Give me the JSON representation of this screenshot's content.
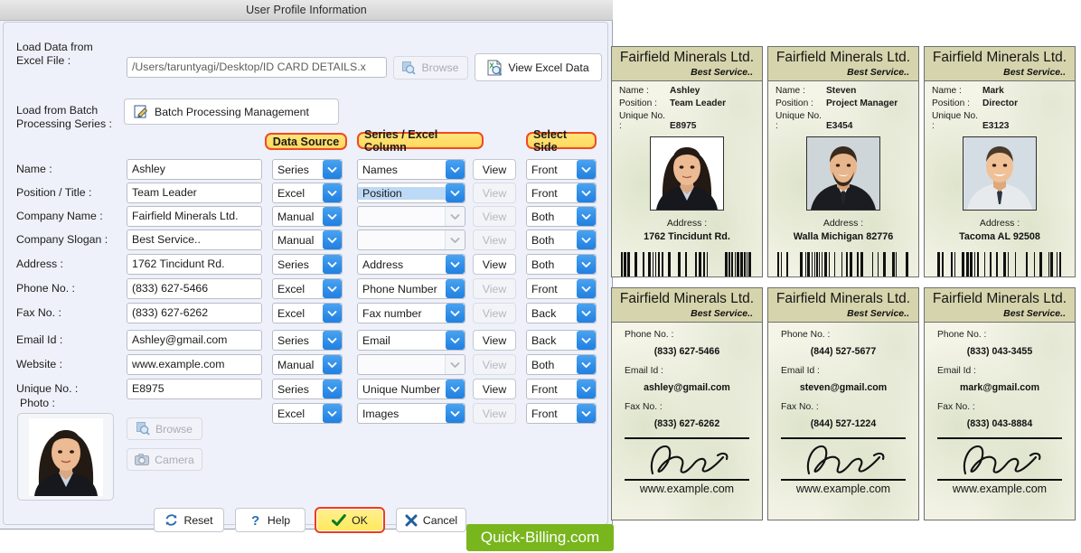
{
  "window": {
    "title": "User Profile Information"
  },
  "top": {
    "excel_label": "Load Data from\nExcel File :",
    "excel_path": "/Users/taruntyagi/Desktop/ID CARD DETAILS.x",
    "browse_label": "Browse",
    "view_excel_label": "View Excel Data",
    "batch_label": "Load from Batch\nProcessing Series :",
    "batch_button": "Batch Processing Management"
  },
  "column_badges": {
    "data_source": "Data Source",
    "series_excel_column": "Series / Excel Column",
    "select_side": "Select Side"
  },
  "rows": [
    {
      "label": "Name :",
      "value": "Ashley",
      "source": "Series",
      "column": "Names",
      "view": "View",
      "view_enabled": true,
      "side": "Front",
      "column_selected": false
    },
    {
      "label": "Position / Title :",
      "value": "Team Leader",
      "source": "Excel",
      "column": "Position",
      "view": "View",
      "view_enabled": false,
      "side": "Front",
      "column_selected": true
    },
    {
      "label": "Company Name :",
      "value": "Fairfield Minerals Ltd.",
      "source": "Manual",
      "column": "",
      "view": "View",
      "view_enabled": false,
      "side": "Both",
      "column_selected": false
    },
    {
      "label": "Company Slogan :",
      "value": "Best Service..",
      "source": "Manual",
      "column": "",
      "view": "View",
      "view_enabled": false,
      "side": "Both",
      "column_selected": false
    },
    {
      "label": "Address :",
      "value": "1762 Tincidunt Rd.",
      "source": "Series",
      "column": "Address",
      "view": "View",
      "view_enabled": true,
      "side": "Both",
      "column_selected": false
    },
    {
      "label": "Phone No. :",
      "value": "(833) 627-5466",
      "source": "Excel",
      "column": "Phone Number",
      "view": "View",
      "view_enabled": false,
      "side": "Front",
      "column_selected": false
    },
    {
      "label": "Fax No. :",
      "value": "(833) 627-6262",
      "source": "Excel",
      "column": "Fax number",
      "view": "View",
      "view_enabled": false,
      "side": "Back",
      "column_selected": false
    },
    {
      "label": "Email Id :",
      "value": "Ashley@gmail.com",
      "source": "Series",
      "column": "Email",
      "view": "View",
      "view_enabled": true,
      "side": "Back",
      "column_selected": false
    },
    {
      "label": "Website :",
      "value": "www.example.com",
      "source": "Manual",
      "column": "",
      "view": "View",
      "view_enabled": false,
      "side": "Both",
      "column_selected": false
    },
    {
      "label": "Unique No. :",
      "value": "E8975",
      "source": "Series",
      "column": "Unique Number",
      "view": "View",
      "view_enabled": true,
      "side": "Front",
      "column_selected": false
    }
  ],
  "photo_row": {
    "label": "Photo :",
    "source": "Excel",
    "column": "Images",
    "view": "View",
    "view_enabled": false,
    "side": "Front",
    "browse_label": "Browse",
    "camera_label": "Camera"
  },
  "footer": {
    "reset": "Reset",
    "help": "Help",
    "ok": "OK",
    "cancel": "Cancel"
  },
  "brand": "Quick-Billing.com",
  "cards": {
    "company": "Fairfield Minerals Ltd.",
    "slogan": "Best Service..",
    "front_keys": {
      "name": "Name :",
      "position": "Position :",
      "unique": "Unique No. :",
      "address": "Address :"
    },
    "back_keys": {
      "phone": "Phone No. :",
      "email": "Email Id :",
      "fax": "Fax No. :"
    },
    "website": "www.example.com",
    "fronts": [
      {
        "name": "Ashley",
        "position": "Team Leader",
        "unique": "E8975",
        "address": "1762 Tincidunt Rd."
      },
      {
        "name": "Steven",
        "position": "Project Manager",
        "unique": "E3454",
        "address": "Walla Michigan 82776"
      },
      {
        "name": "Mark",
        "position": "Director",
        "unique": "E3123",
        "address": "Tacoma AL 92508"
      }
    ],
    "backs": [
      {
        "phone": "(833) 627-5466",
        "email": "ashley@gmail.com",
        "fax": "(833) 627-6262"
      },
      {
        "phone": "(844) 527-5677",
        "email": "steven@gmail.com",
        "fax": "(844) 527-1224"
      },
      {
        "phone": "(833) 043-3455",
        "email": "mark@gmail.com",
        "fax": "(833) 043-8884"
      }
    ]
  },
  "colors": {
    "badge_fill": "#ffd95e",
    "badge_border": "#f04a23",
    "combo_arrow": "#2f8de8",
    "card_header": "#d6d4ac",
    "brand_green": "#79b61d"
  }
}
